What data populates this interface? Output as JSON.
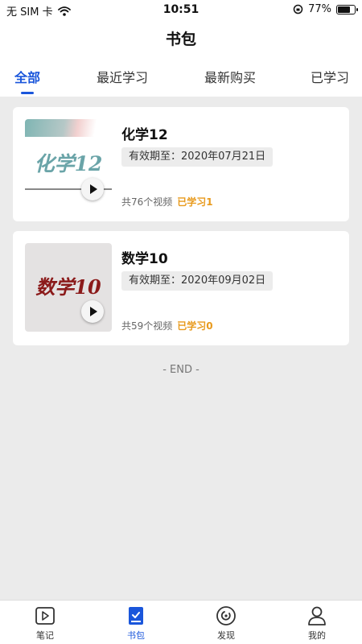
{
  "status": {
    "carrier": "无 SIM 卡",
    "time": "10:51",
    "battery": "77%",
    "battery_level": 0.77
  },
  "header": {
    "title": "书包"
  },
  "tabs": [
    {
      "label": "全部",
      "active": true
    },
    {
      "label": "最近学习",
      "active": false
    },
    {
      "label": "最新购买",
      "active": false
    },
    {
      "label": "已学习",
      "active": false
    }
  ],
  "courses": [
    {
      "title": "化学12",
      "thumb_text": "化学12",
      "validity": "有效期至：2020年07月21日",
      "video_count": "共76个视频",
      "studied": "已学习1"
    },
    {
      "title": "数学10",
      "thumb_text": "数学10",
      "validity": "有效期至：2020年09月02日",
      "video_count": "共59个视频",
      "studied": "已学习0"
    }
  ],
  "end_label": "- END -",
  "nav": [
    {
      "label": "笔记",
      "icon": "video-note-icon",
      "active": false
    },
    {
      "label": "书包",
      "icon": "bookbag-icon",
      "active": true
    },
    {
      "label": "发现",
      "icon": "discover-icon",
      "active": false
    },
    {
      "label": "我的",
      "icon": "profile-icon",
      "active": false
    }
  ],
  "colors": {
    "accent": "#1a56db",
    "studied": "#e89a1d",
    "background": "#ebebeb"
  }
}
